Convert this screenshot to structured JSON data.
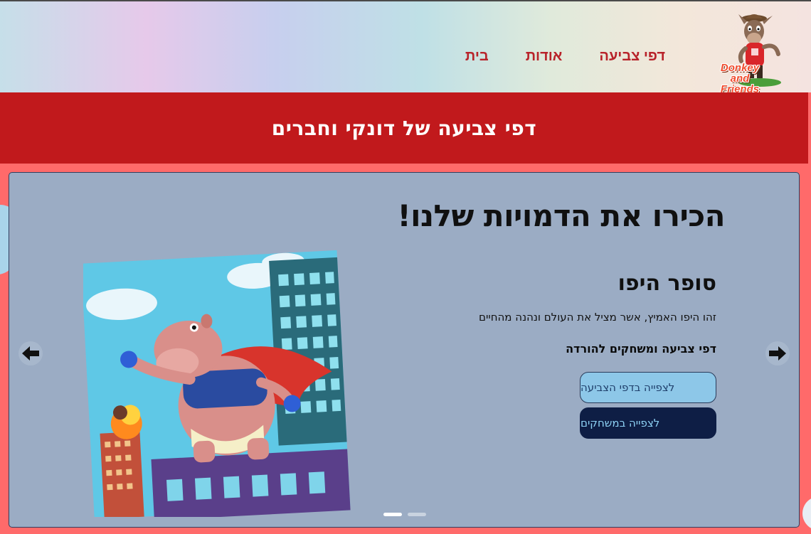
{
  "header": {
    "nav": [
      {
        "label": "בית"
      },
      {
        "label": "אודות"
      },
      {
        "label": "דפי צביעה"
      }
    ],
    "logo_text": [
      "Donkey",
      "and",
      "Friends"
    ]
  },
  "banner": {
    "title": "דפי צביעה של דונקי וחברים"
  },
  "carousel": {
    "title": "הכירו את הדמויות שלנו!",
    "slide": {
      "name": "סופר היפו",
      "description": "זהו היפו האמיץ, אשר מציל את העולם ונהנה מהחיים",
      "subtitle": "דפי צביעה ומשחקים להורדה",
      "button_coloring": "לצפייה בדפי הצביעה",
      "button_games": "לצפייה במשחקים"
    },
    "dots_count": 2,
    "active_dot": 0
  },
  "colors": {
    "page_bg": "#ff6a6a",
    "banner": "#c1191c",
    "nav_link": "#b8232a",
    "card_bg": "#9bacc4",
    "btn_light": "#8dc7e8",
    "btn_dark": "#0e1e45"
  }
}
